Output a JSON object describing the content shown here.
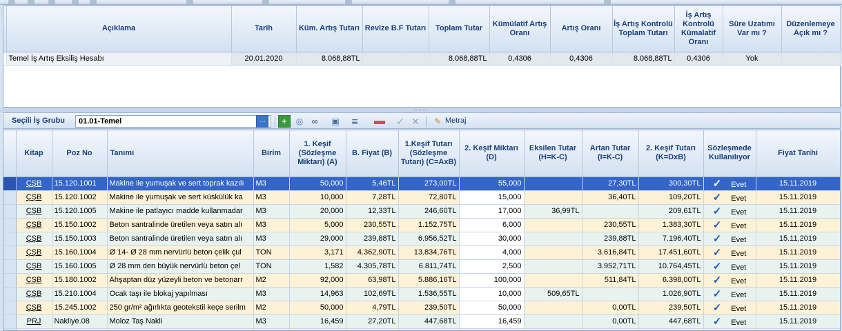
{
  "upper_grid": {
    "headers": [
      "Açıklama",
      "Tarih",
      "Küm. Artış Tutarı",
      "Revize B.F Tutarı",
      "Toplam Tutar",
      "Kümülatif Artış Oranı",
      "Artış Oranı",
      "İş Artış Kontrolü Toplam Tutarı",
      "İş Artış Kontrolü Kümalatif Oranı",
      "Süre Uzatımı Var mı ?",
      "Düzenlemeye Açık mı ?"
    ],
    "rows": [
      {
        "aciklama": "Temel İş Artış Eksiliş Hesabı",
        "tarih": "20.01.2020",
        "kum_artis": "8.068,88TL",
        "revize": "",
        "toplam": "8.068,88TL",
        "kum_oran": "0,4306",
        "artis_oran": "0,4306",
        "kontrol_toplam": "8.068,88TL",
        "kontrol_oran": "0,4306",
        "sure": "Yok",
        "duzenleme": ""
      }
    ]
  },
  "group_bar": {
    "label": "Seçili İş Grubu",
    "value": "01.01-Temel",
    "metraj_label": "Metraj"
  },
  "lower_grid": {
    "headers": [
      "Kitap",
      "Poz No",
      "Tanımı",
      "Birim",
      "1. Keşif (Sözleşme Miktarı) (A)",
      "B. Fiyat (B)",
      "1.Keşif Tutarı (Sözleşme Tutarı) (C=AxB)",
      "2. Keşif Miktarı (D)",
      "Eksilen Tutar (H=K-C)",
      "Artan Tutar (I=K-C)",
      "2. Keşif Tutarı (K=DxB)",
      "Sözleşmede Kullanılıyor",
      "Fiyat Tarihi"
    ],
    "rows": [
      {
        "kitap": "ÇŞB",
        "poz": "15.120.1001",
        "tanim": "Makine ile yumuşak ve sert toprak kazılı",
        "birim": "M3",
        "kesif1": "50,000",
        "fiyat": "5,46TL",
        "tutar1": "273,00TL",
        "kesif2": "55,000",
        "eksilen": "",
        "artan": "27,30TL",
        "tutar2": "300,30TL",
        "kullan": "Evet",
        "tarih": "15.11.2019"
      },
      {
        "kitap": "ÇŞB",
        "poz": "15.120.1002",
        "tanim": "Makine ile yumuşak ve sert küskülük ka",
        "birim": "M3",
        "kesif1": "10,000",
        "fiyat": "7,28TL",
        "tutar1": "72,80TL",
        "kesif2": "15,000",
        "eksilen": "",
        "artan": "36,40TL",
        "tutar2": "109,20TL",
        "kullan": "Evet",
        "tarih": "15.11.2019"
      },
      {
        "kitap": "ÇŞB",
        "poz": "15.120.1005",
        "tanim": "Makine ile patlayıcı madde kullanmadar",
        "birim": "M3",
        "kesif1": "20,000",
        "fiyat": "12,33TL",
        "tutar1": "246,60TL",
        "kesif2": "17,000",
        "eksilen": "36,99TL",
        "artan": "",
        "tutar2": "209,61TL",
        "kullan": "Evet",
        "tarih": "15.11.2019"
      },
      {
        "kitap": "ÇŞB",
        "poz": "15.150.1002",
        "tanim": "Beton santralinde üretilen veya satın alı",
        "birim": "M3",
        "kesif1": "5,000",
        "fiyat": "230,55TL",
        "tutar1": "1.152,75TL",
        "kesif2": "6,000",
        "eksilen": "",
        "artan": "230,55TL",
        "tutar2": "1.383,30TL",
        "kullan": "Evet",
        "tarih": "15.11.2019"
      },
      {
        "kitap": "ÇŞB",
        "poz": "15.150.1003",
        "tanim": "Beton santralinde üretilen veya satın alı",
        "birim": "M3",
        "kesif1": "29,000",
        "fiyat": "239,88TL",
        "tutar1": "6.956,52TL",
        "kesif2": "30,000",
        "eksilen": "",
        "artan": "239,88TL",
        "tutar2": "7.196,40TL",
        "kullan": "Evet",
        "tarih": "15.11.2019"
      },
      {
        "kitap": "ÇŞB",
        "poz": "15.160.1004",
        "tanim": "Ø 14- Ø 28 mm nervürlü beton çelik çul",
        "birim": "TON",
        "kesif1": "3,171",
        "fiyat": "4.362,90TL",
        "tutar1": "13.834,76TL",
        "kesif2": "4,000",
        "eksilen": "",
        "artan": "3.616,84TL",
        "tutar2": "17.451,60TL",
        "kullan": "Evet",
        "tarih": "15.11.2019"
      },
      {
        "kitap": "ÇŞB",
        "poz": "15.160.1005",
        "tanim": "Ø 28 mm den büyük nervürlü beton çel",
        "birim": "TON",
        "kesif1": "1,582",
        "fiyat": "4.305,78TL",
        "tutar1": "6.811,74TL",
        "kesif2": "2,500",
        "eksilen": "",
        "artan": "3.952,71TL",
        "tutar2": "10.764,45TL",
        "kullan": "Evet",
        "tarih": "15.11.2019"
      },
      {
        "kitap": "ÇŞB",
        "poz": "15.180.1002",
        "tanim": "Ahşaptan düz yüzeyli beton ve betonarr",
        "birim": "M2",
        "kesif1": "92,000",
        "fiyat": "63,98TL",
        "tutar1": "5.886,16TL",
        "kesif2": "100,000",
        "eksilen": "",
        "artan": "511,84TL",
        "tutar2": "6.398,00TL",
        "kullan": "Evet",
        "tarih": "15.11.2019"
      },
      {
        "kitap": "ÇŞB",
        "poz": "15.210.1004",
        "tanim": "Ocak taşı ile blokaj yapılması",
        "birim": "M3",
        "kesif1": "14,963",
        "fiyat": "102,69TL",
        "tutar1": "1.536,55TL",
        "kesif2": "10,000",
        "eksilen": "509,65TL",
        "artan": "",
        "tutar2": "1.026,90TL",
        "kullan": "Evet",
        "tarih": "15.11.2019"
      },
      {
        "kitap": "ÇŞB",
        "poz": "15.245.1002",
        "tanim": "250 gr/m² ağırlıkta geotekstil keçe serilm",
        "birim": "M2",
        "kesif1": "50,000",
        "fiyat": "4,79TL",
        "tutar1": "239,50TL",
        "kesif2": "50,000",
        "eksilen": "",
        "artan": "0,00TL",
        "tutar2": "239,50TL",
        "kullan": "Evet",
        "tarih": "15.11.2019"
      },
      {
        "kitap": "PRJ",
        "poz": "Nakliye.08",
        "tanim": "Moloz Taş Nakli",
        "birim": "M3",
        "kesif1": "16,459",
        "fiyat": "27,20TL",
        "tutar1": "447,68TL",
        "kesif2": "16,459",
        "eksilen": "",
        "artan": "0,00TL",
        "tutar2": "447,68TL",
        "kullan": "Evet",
        "tarih": "15.11.2019"
      }
    ]
  },
  "colors": {
    "header_text": "#1b3f78",
    "selected_row": "#3465c9",
    "row_odd": "#e8f3ef",
    "row_even": "#fdf2d6"
  }
}
